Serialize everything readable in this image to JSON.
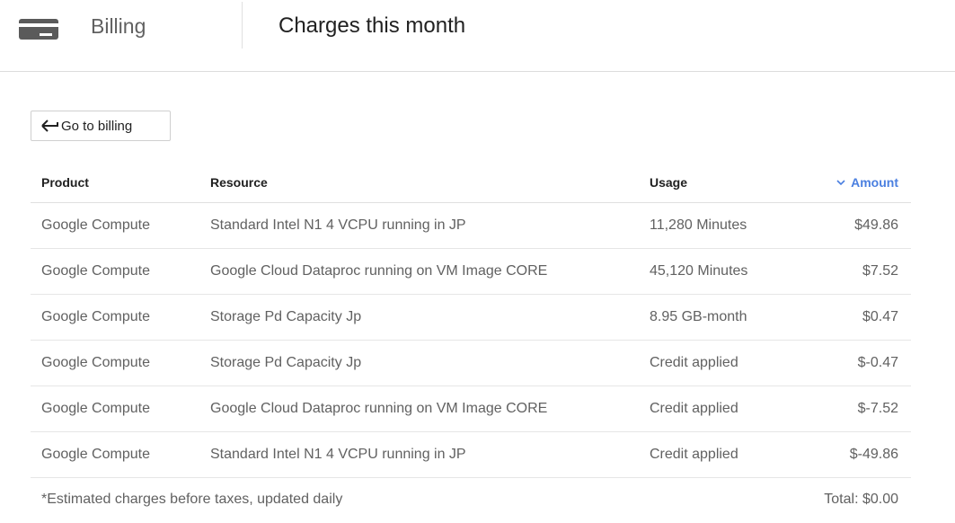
{
  "header": {
    "app_name": "Billing",
    "page_title": "Charges this month",
    "icon": "credit-card-icon"
  },
  "back_button": {
    "label": "Go to billing",
    "icon": "arrow-back-icon"
  },
  "table": {
    "columns": {
      "product": "Product",
      "resource": "Resource",
      "usage": "Usage",
      "amount": "Amount"
    },
    "sort": {
      "column": "Amount",
      "direction": "descending",
      "icon": "chevron-down-icon",
      "color": "#4a7fe0"
    },
    "rows": [
      {
        "product": "Google Compute",
        "resource": "Standard Intel N1 4 VCPU running in JP",
        "usage": "11,280 Minutes",
        "amount": "$49.86"
      },
      {
        "product": "Google Compute",
        "resource": "Google Cloud Dataproc running on VM Image CORE",
        "usage": "45,120 Minutes",
        "amount": "$7.52"
      },
      {
        "product": "Google Compute",
        "resource": "Storage Pd Capacity Jp",
        "usage": "8.95 GB-month",
        "amount": "$0.47"
      },
      {
        "product": "Google Compute",
        "resource": "Storage Pd Capacity Jp",
        "usage": "Credit applied",
        "amount": "$-0.47"
      },
      {
        "product": "Google Compute",
        "resource": "Google Cloud Dataproc running on VM Image CORE",
        "usage": "Credit applied",
        "amount": "$-7.52"
      },
      {
        "product": "Google Compute",
        "resource": "Standard Intel N1 4 VCPU running in JP",
        "usage": "Credit applied",
        "amount": "$-49.86"
      }
    ]
  },
  "footer": {
    "note": "*Estimated charges before taxes, updated daily",
    "total": "Total: $0.00"
  }
}
